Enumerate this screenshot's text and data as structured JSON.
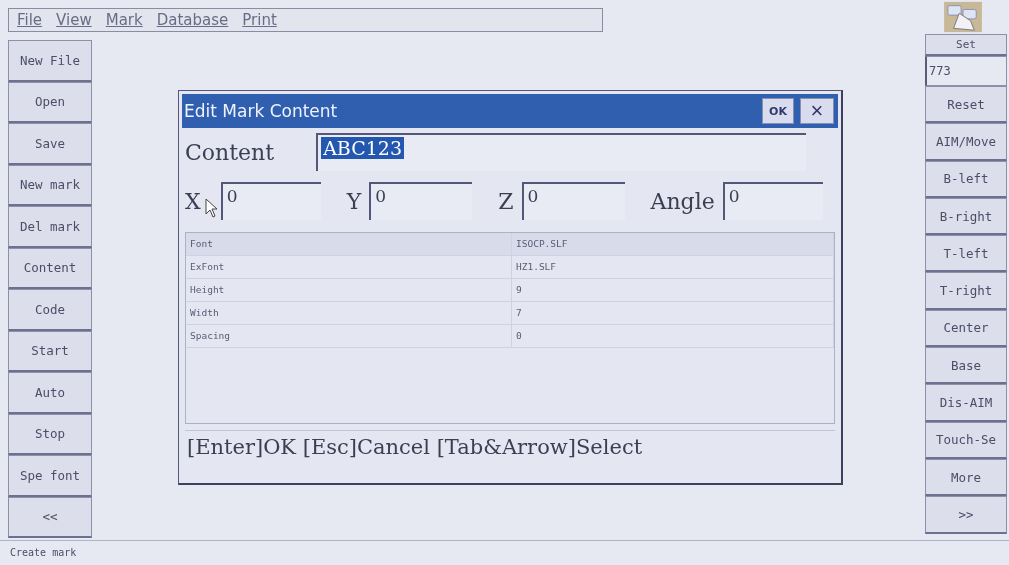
{
  "menu": [
    "File",
    "View",
    "Mark",
    "Database",
    "Print"
  ],
  "left_buttons": [
    "New File",
    "Open",
    "Save",
    "New mark",
    "Del mark",
    "Content",
    "Code",
    "Start",
    "Auto",
    "Stop",
    "Spe font",
    "<<"
  ],
  "right_panel": {
    "set_label": "Set",
    "value": "773",
    "buttons": [
      "Reset",
      "AIM/Move",
      "B-left",
      "B-right",
      "T-left",
      "T-right",
      "Center",
      "Base",
      "Dis-AIM",
      "Touch-Se",
      "More",
      ">>"
    ]
  },
  "dialog": {
    "title": "Edit Mark Content",
    "ok": "OK",
    "close": "×",
    "content_label": "Content",
    "content_value": "ABC123",
    "coords": [
      {
        "label": "X",
        "value": "0"
      },
      {
        "label": "Y",
        "value": "0"
      },
      {
        "label": "Z",
        "value": "0"
      },
      {
        "label": "Angle",
        "value": "0"
      }
    ],
    "properties": [
      {
        "name": "Font",
        "value": "ISOCP.SLF",
        "selected": true
      },
      {
        "name": "ExFont",
        "value": "HZ1.SLF",
        "selected": false
      },
      {
        "name": "Height",
        "value": "9",
        "selected": false
      },
      {
        "name": "Width",
        "value": "7",
        "selected": false
      },
      {
        "name": "Spacing",
        "value": "0",
        "selected": false
      }
    ],
    "hint": "[Enter]OK [Esc]Cancel [Tab&Arrow]Select"
  },
  "status_bar": "Create mark"
}
